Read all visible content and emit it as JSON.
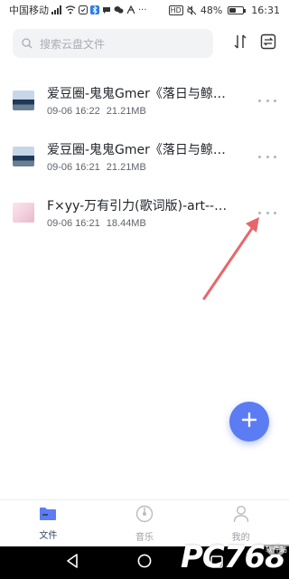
{
  "status_bar": {
    "carrier": "中国移动",
    "signal_text": "4G",
    "hd_label": "HD",
    "battery": "48%",
    "battery_level": 0.48,
    "time": "16:31"
  },
  "search": {
    "placeholder": "搜索云盘文件"
  },
  "files": [
    {
      "name": "爱豆圈-鬼鬼Gmer《落日与鲸鱼》",
      "date": "09-06 16:22",
      "size": "21.21MB",
      "thumb": "video-thumb-sea"
    },
    {
      "name": "爱豆圈-鬼鬼Gmer《落日与鲸鱼》",
      "date": "09-06 16:21",
      "size": "21.21MB",
      "thumb": "video-thumb-sea"
    },
    {
      "name": "F×yy-万有引力(歌词版)-art--F×yy",
      "date": "09-06 16:21",
      "size": "18.44MB",
      "thumb": "video-thumb-pink"
    }
  ],
  "tabs": [
    {
      "label": "文件",
      "icon": "folder-icon",
      "active": true
    },
    {
      "label": "音乐",
      "icon": "music-disc-icon",
      "active": false
    },
    {
      "label": "我的",
      "icon": "user-icon",
      "active": false
    }
  ],
  "watermark": {
    "text": "PC768",
    "sub": "软件站"
  },
  "colors": {
    "accent": "#5b7cf3",
    "annotation_arrow": "#e8666b",
    "tab_active": "#3b4a66",
    "tab_inactive": "#9a9da3"
  }
}
